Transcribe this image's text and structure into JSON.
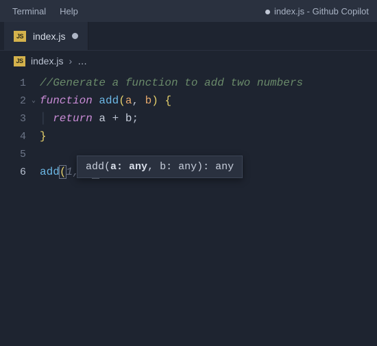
{
  "titlebar": {
    "menu": {
      "terminal": "Terminal",
      "help": "Help"
    },
    "modified_indicator": "●",
    "window_title": "index.js - Github Copilot"
  },
  "tab": {
    "icon_text": "JS",
    "filename": "index.js"
  },
  "breadcrumb": {
    "icon_text": "JS",
    "filename": "index.js",
    "chevron": "›",
    "more": "…"
  },
  "lines": {
    "l1": "1",
    "l2": "2",
    "l3": "3",
    "l4": "4",
    "l5": "5",
    "l6": "6"
  },
  "code": {
    "comment": "//Generate a function to add two numbers",
    "kw_function": "function",
    "fn_name": "add",
    "open_paren": "(",
    "param_a": "a",
    "comma_sp": ", ",
    "param_b": "b",
    "close_paren": ")",
    "open_brace": " {",
    "kw_return": "return",
    "expr_a": " a ",
    "op_plus": "+",
    "expr_b": " b",
    "semi": ";",
    "close_brace": "}",
    "call_fn": "add",
    "call_open": "(",
    "ghost_a": "1",
    "ghost_comma": ", ",
    "ghost_b": "2",
    "call_close": ")",
    "ghost_semi": ";"
  },
  "tooltip": {
    "fn": "add",
    "open": "(",
    "p_a_name": "a",
    "colon_any_a": ": any",
    "comma": ", ",
    "p_b_name": "b",
    "colon_any_b": ": any",
    "close_ret": "): any"
  }
}
